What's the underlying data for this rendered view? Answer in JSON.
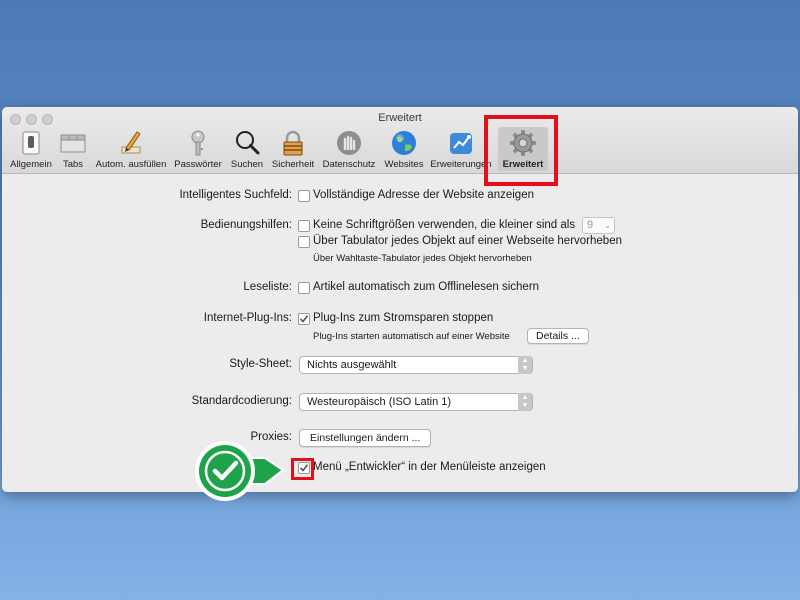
{
  "window": {
    "title": "Erweitert"
  },
  "toolbar": {
    "items": [
      {
        "label": "Allgemein",
        "icon": "phone-switch-icon"
      },
      {
        "label": "Tabs",
        "icon": "tabs-icon"
      },
      {
        "label": "Autom. ausfüllen",
        "icon": "pencil-icon"
      },
      {
        "label": "Passwörter",
        "icon": "key-icon"
      },
      {
        "label": "Suchen",
        "icon": "magnifier-icon"
      },
      {
        "label": "Sicherheit",
        "icon": "lock-icon"
      },
      {
        "label": "Datenschutz",
        "icon": "hand-icon"
      },
      {
        "label": "Websites",
        "icon": "globe-icon"
      },
      {
        "label": "Erweiterungen",
        "icon": "puzzle-icon"
      },
      {
        "label": "Erweitert",
        "icon": "gear-icon",
        "selected": true
      }
    ]
  },
  "settings": {
    "smart_search": {
      "label": "Intelligentes Suchfeld:",
      "option": "Vollständige Adresse der Website anzeigen",
      "checked": false
    },
    "accessibility": {
      "label": "Bedienungshilfen:",
      "option1": "Keine Schriftgrößen verwenden, die kleiner sind als",
      "font_size": "9",
      "option2": "Über Tabulator jedes Objekt auf einer Webseite hervorheben",
      "hint": "Über Wahltaste-Tabulator jedes Objekt hervorheben"
    },
    "reading_list": {
      "label": "Leseliste:",
      "option": "Artikel automatisch zum Offlinelesen sichern"
    },
    "plugins": {
      "label": "Internet-Plug-Ins:",
      "option": "Plug-Ins zum Stromsparen stoppen",
      "checked": true,
      "hint": "Plug-Ins starten automatisch auf einer Website",
      "details_button": "Details ..."
    },
    "style_sheet": {
      "label": "Style-Sheet:",
      "value": "Nichts ausgewählt"
    },
    "encoding": {
      "label": "Standardcodierung:",
      "value": "Westeuropäisch (ISO Latin 1)"
    },
    "proxies": {
      "label": "Proxies:",
      "button": "Einstellungen ändern ..."
    },
    "develop_menu": {
      "option": "Menü „Entwickler“ in der Menüleiste anzeigen",
      "checked": true
    }
  },
  "help_label": "?",
  "colors": {
    "highlight": "#e3101a",
    "badge_green": "#1fa34a",
    "checkmark": "#555555"
  }
}
